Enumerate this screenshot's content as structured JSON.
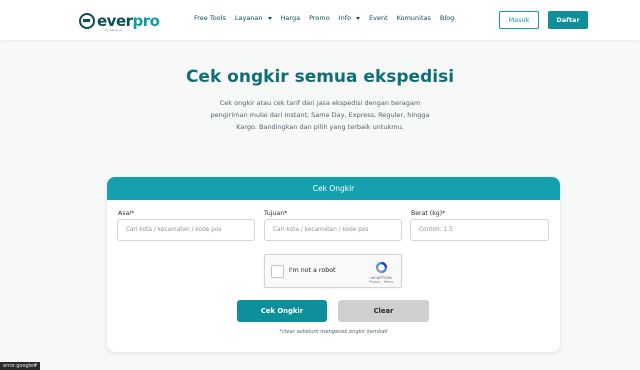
{
  "brand": {
    "name_part1": "ever",
    "name_part2": "pro",
    "tagline": "by paper.id"
  },
  "nav": {
    "items": [
      {
        "label": "Free Tools",
        "dropdown": false
      },
      {
        "label": "Layanan",
        "dropdown": true
      },
      {
        "label": "Harga",
        "dropdown": false
      },
      {
        "label": "Promo",
        "dropdown": false
      },
      {
        "label": "Info",
        "dropdown": true
      },
      {
        "label": "Event",
        "dropdown": false
      },
      {
        "label": "Komunitas",
        "dropdown": false
      },
      {
        "label": "Blog",
        "dropdown": false
      }
    ],
    "login_label": "Masuk",
    "register_label": "Daftar"
  },
  "hero": {
    "title": "Cek ongkir semua ekspedisi",
    "description": "Cek ongkir atau cek tarif dari jasa ekspedisi dengan beragam pengiriman mulai dari Instant, Same Day, Express, Reguler, hingga Kargo. Bandingkan dan pilih yang terbaik untukmu."
  },
  "form": {
    "header": "Cek Ongkir",
    "origin": {
      "label": "Asal*",
      "placeholder": "Cari kota / kecamatan / kode pos"
    },
    "destination": {
      "label": "Tujuan*",
      "placeholder": "Cari kota / kecamatan / kode pos"
    },
    "weight": {
      "label": "Berat (kg)*",
      "placeholder": "Contoh: 1.5"
    },
    "captcha": {
      "label": "I'm not a robot",
      "brand": "reCAPTCHA",
      "links": "Privacy - Terms"
    },
    "submit_label": "Cek Ongkir",
    "clear_label": "Clear",
    "note": "*clear sebelum mengecek ongkir kembali"
  },
  "status_bar": {
    "text": "error.google#"
  },
  "colors": {
    "primary": "#0e8f9a",
    "header_bar": "#14a0ad",
    "brand_dark": "#0a4f53",
    "title": "#0f6e77"
  }
}
